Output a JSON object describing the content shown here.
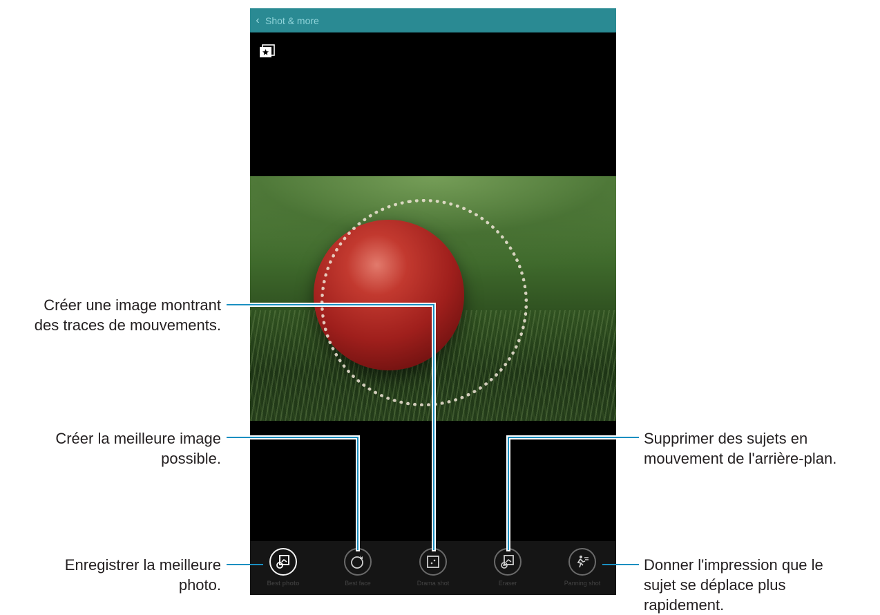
{
  "header": {
    "title": "Shot & more",
    "back_icon": "chevron-left-icon"
  },
  "icons": {
    "gallery": "gallery-star-icon"
  },
  "modes": [
    {
      "label": "Best photo",
      "icon": "best-photo-icon",
      "active": true
    },
    {
      "label": "Best face",
      "icon": "best-face-icon",
      "active": false
    },
    {
      "label": "Drama shot",
      "icon": "drama-shot-icon",
      "active": false
    },
    {
      "label": "Eraser",
      "icon": "eraser-icon",
      "active": false
    },
    {
      "label": "Panning shot",
      "icon": "panning-shot-icon",
      "active": false
    }
  ],
  "annotations": {
    "drama": [
      "Créer une image montrant",
      "des traces de mouvements."
    ],
    "best_face": [
      "Créer la meilleure image",
      "possible."
    ],
    "best_photo": [
      "Enregistrer la meilleure",
      "photo."
    ],
    "eraser": [
      "Supprimer des sujets en",
      "mouvement de l'arrière-plan."
    ],
    "panning": [
      "Donner l'impression que le",
      "sujet se déplace plus",
      "rapidement."
    ]
  },
  "colors": {
    "titlebar": "#2a8a93",
    "leader": "#1a8fc1"
  }
}
